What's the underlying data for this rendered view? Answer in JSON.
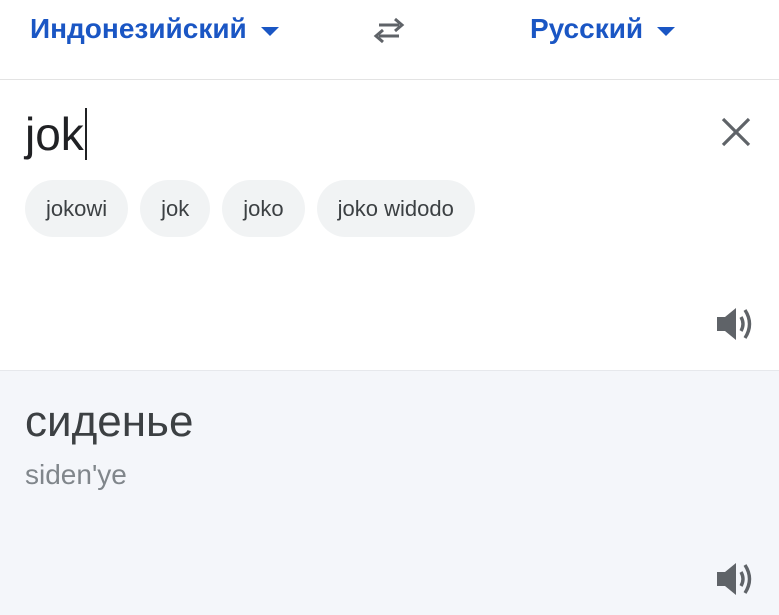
{
  "languages": {
    "source": "Индонезийский",
    "target": "Русский"
  },
  "input": {
    "value": "jok"
  },
  "suggestions": [
    "jokowi",
    "jok",
    "joko",
    "joko widodo"
  ],
  "translation": {
    "text": "сиденье",
    "transliteration": "siden'ye"
  },
  "icons": {
    "swap": "swap-arrows-icon",
    "clear": "close-icon",
    "speaker": "speaker-icon",
    "dropdown": "caret-down-icon"
  },
  "colors": {
    "accent": "#1a56c4",
    "text_primary": "#202124",
    "text_secondary": "#80868b",
    "icon": "#5f6368",
    "chip_bg": "#f1f3f4",
    "result_bg": "#f4f6fa"
  }
}
